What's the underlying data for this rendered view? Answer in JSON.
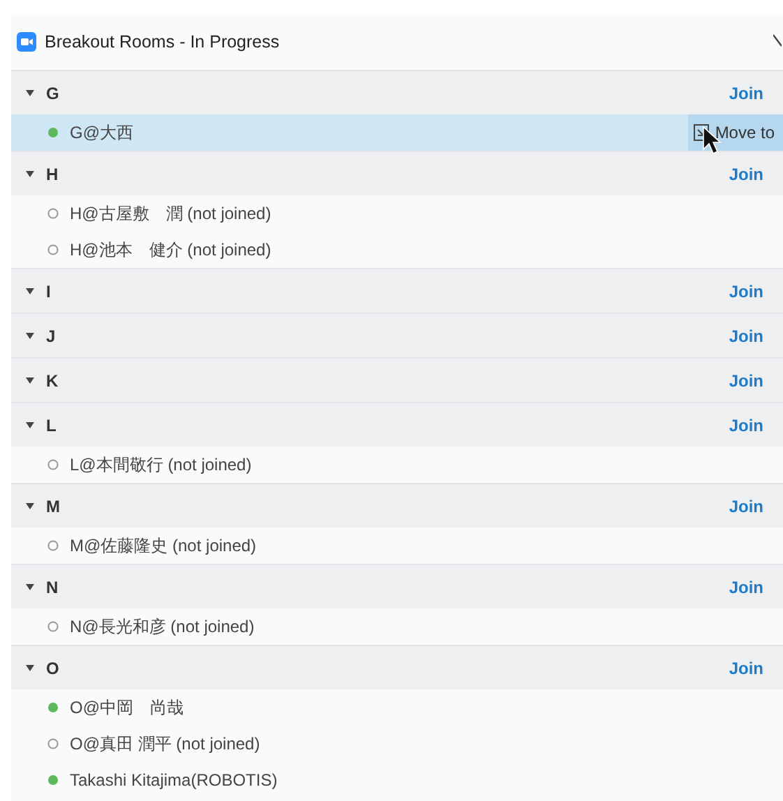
{
  "window": {
    "title": "Breakout Rooms - In Progress"
  },
  "rooms": [
    {
      "name": "G",
      "expanded": true,
      "action": "Join",
      "members": [
        {
          "name": "G@大西",
          "joined": true,
          "selected": true,
          "action": "Move to"
        }
      ]
    },
    {
      "name": "H",
      "expanded": true,
      "action": "Join",
      "members": [
        {
          "name": "H@古屋敷　潤 (not joined)",
          "joined": false,
          "selected": false
        },
        {
          "name": "H@池本　健介 (not joined)",
          "joined": false,
          "selected": false
        }
      ]
    },
    {
      "name": "I",
      "expanded": true,
      "action": "Join"
    },
    {
      "name": "J",
      "expanded": true,
      "action": "Join"
    },
    {
      "name": "K",
      "expanded": true,
      "action": "Join"
    },
    {
      "name": "L",
      "expanded": true,
      "action": "Join",
      "members": [
        {
          "name": "L@本間敬行 (not joined)",
          "joined": false,
          "selected": false
        }
      ]
    },
    {
      "name": "M",
      "expanded": true,
      "action": "Join",
      "members": [
        {
          "name": "M@佐藤隆史 (not joined)",
          "joined": false,
          "selected": false
        }
      ]
    },
    {
      "name": "N",
      "expanded": true,
      "action": "Join",
      "members": [
        {
          "name": "N@長光和彦 (not joined)",
          "joined": false,
          "selected": false
        }
      ]
    },
    {
      "name": "O",
      "expanded": true,
      "action": "Join",
      "members": [
        {
          "name": "O@中岡　尚哉",
          "joined": true,
          "selected": false
        },
        {
          "name": "O@真田 潤平 (not joined)",
          "joined": false,
          "selected": false
        },
        {
          "name": "Takashi Kitajima(ROBOTIS)",
          "joined": true,
          "selected": false
        }
      ]
    }
  ]
}
